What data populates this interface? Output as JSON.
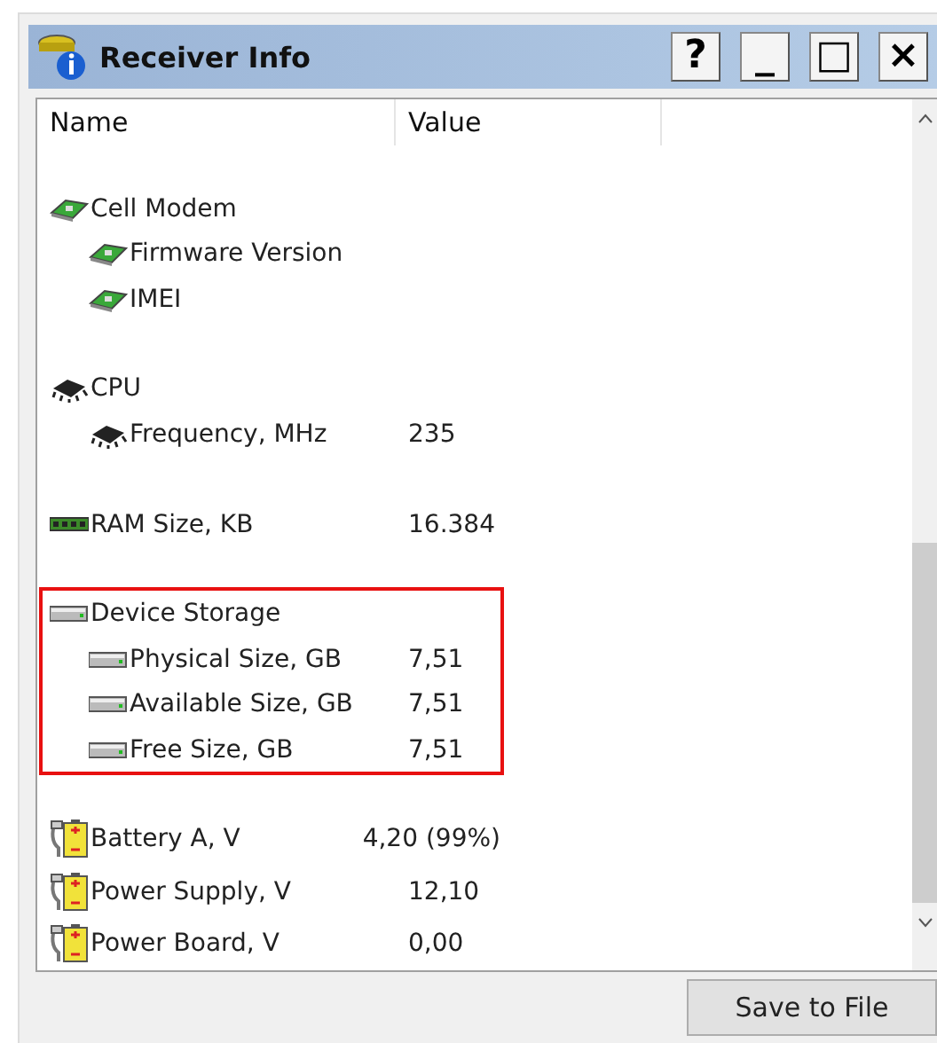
{
  "window": {
    "title": "Receiver Info",
    "buttons": [
      "?",
      "_",
      "□",
      "×"
    ]
  },
  "table": {
    "columns": [
      "Name",
      "Value"
    ],
    "groups": [
      {
        "name": "Cell Modem",
        "kind": "modem",
        "highlighted": false,
        "children": [
          {
            "name": "Firmware Version"
          },
          {
            "name": "IMEI"
          }
        ]
      },
      {
        "name": "CPU",
        "kind": "cpu",
        "highlighted": false,
        "children": [
          {
            "name": "Frequency, MHz",
            "value": "235"
          }
        ]
      },
      {
        "name": "RAM Size, KB",
        "kind": "ram",
        "value": "16.384",
        "highlighted": false
      },
      {
        "name": "Device Storage",
        "kind": "storage",
        "highlighted": true,
        "children": [
          {
            "name": "Physical Size, GB",
            "value": "7,51"
          },
          {
            "name": "Available Size, GB",
            "value": "7,51"
          },
          {
            "name": "Free Size, GB",
            "value": "7,51"
          }
        ]
      },
      {
        "name": "Battery A, V",
        "kind": "battery",
        "value": "4,20 (99%)",
        "highlighted": false,
        "spacer": false
      },
      {
        "name": "Power Supply, V",
        "kind": "battery",
        "value": "12,10",
        "highlighted": false,
        "spacer": false
      },
      {
        "name": "Power Board, V",
        "kind": "battery",
        "value": "0,00",
        "highlighted": false,
        "spacer": false
      }
    ]
  },
  "buttons": [
    "Save to File"
  ]
}
